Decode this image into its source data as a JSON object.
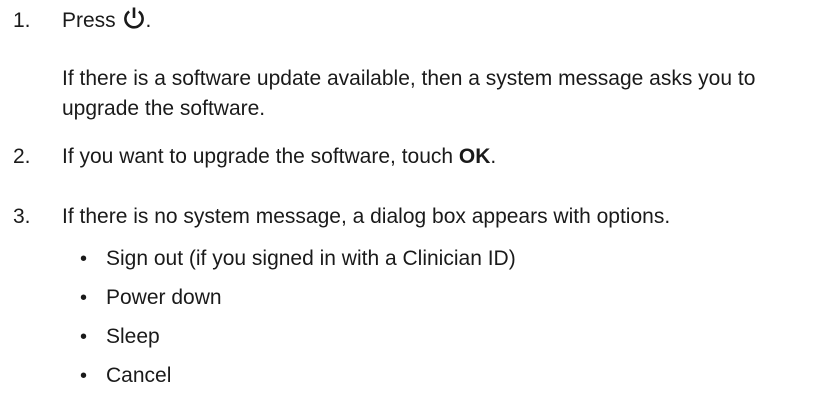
{
  "steps": [
    {
      "number": "1.",
      "text_before_icon": "Press ",
      "icon": "power-icon",
      "text_after_icon": ".",
      "note_line1": "If there is a software update available, then a system message asks you to",
      "note_line2": "upgrade the software."
    },
    {
      "number": "2.",
      "text": "If you want to upgrade the software, touch ",
      "bold": "OK",
      "text_after": "."
    },
    {
      "number": "3.",
      "text": "If there is no system message, a dialog box appears with options."
    }
  ],
  "options": [
    "Sign out (if you signed in with a Clinician ID)",
    "Power down",
    "Sleep",
    "Cancel"
  ]
}
